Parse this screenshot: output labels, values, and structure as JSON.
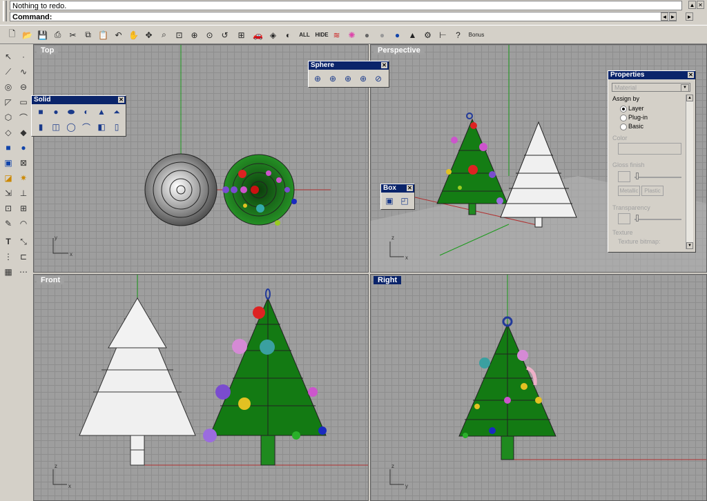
{
  "command": {
    "history_text": "Nothing to redo.",
    "prompt_label": "Command:",
    "prompt_value": ""
  },
  "main_toolbar": {
    "labels": {
      "all": "ALL",
      "hide": "HIDE",
      "bonus": "Bonus"
    }
  },
  "viewports": {
    "top": {
      "label": "Top"
    },
    "perspective": {
      "label": "Perspective"
    },
    "front": {
      "label": "Front"
    },
    "right": {
      "label": "Right"
    }
  },
  "palettes": {
    "solid": {
      "title": "Solid"
    },
    "sphere": {
      "title": "Sphere"
    },
    "box": {
      "title": "Box"
    }
  },
  "properties": {
    "title": "Properties",
    "dropdown_value": "Material",
    "assign_by": "Assign by",
    "options": [
      "Layer",
      "Plug-in",
      "Basic"
    ],
    "selected": "Layer",
    "color_label": "Color",
    "gloss_label": "Gloss finish",
    "metallic": "Metallic",
    "plastic": "Plastic",
    "transparency_label": "Transparency",
    "texture_label": "Texture",
    "texture_bitmap_label": "Texture bitmap:"
  },
  "colors": {
    "viewport_bg": "#9e9e9e",
    "active_title": "#0a246a",
    "tree_green": "#137a13",
    "tree_white": "#f0f0f0",
    "trunk_green": "#1f8a1f"
  }
}
